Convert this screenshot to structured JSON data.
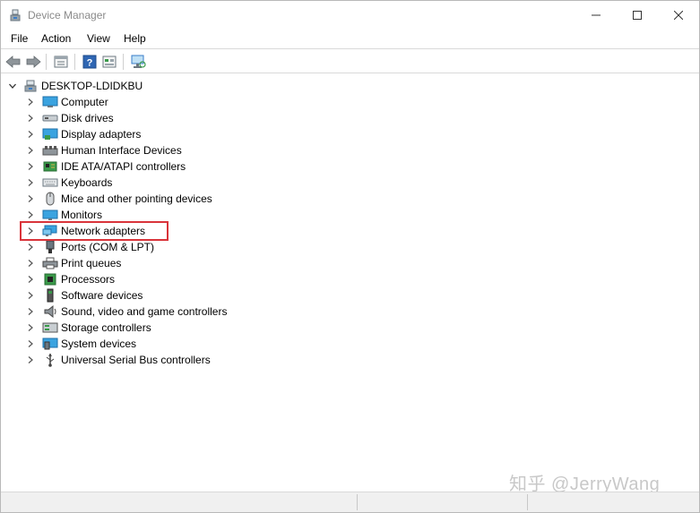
{
  "window": {
    "title": "Device Manager",
    "controls": {
      "minimize": "minimize-icon",
      "maximize": "maximize-icon",
      "close": "close-icon"
    }
  },
  "menu": [
    "File",
    "Action",
    "View",
    "Help"
  ],
  "toolbar": [
    "back-icon",
    "forward-icon",
    "properties-icon",
    "help-icon",
    "view-icon",
    "scan-hardware-icon"
  ],
  "tree": {
    "root": "DESKTOP-LDIDKBU",
    "categories": [
      {
        "label": "Computer",
        "icon": "computer-icon"
      },
      {
        "label": "Disk drives",
        "icon": "disk-drive-icon"
      },
      {
        "label": "Display adapters",
        "icon": "display-adapter-icon"
      },
      {
        "label": "Human Interface Devices",
        "icon": "hid-icon"
      },
      {
        "label": "IDE ATA/ATAPI controllers",
        "icon": "ide-controller-icon"
      },
      {
        "label": "Keyboards",
        "icon": "keyboard-icon"
      },
      {
        "label": "Mice and other pointing devices",
        "icon": "mouse-icon"
      },
      {
        "label": "Monitors",
        "icon": "monitor-icon"
      },
      {
        "label": "Network adapters",
        "icon": "network-adapter-icon"
      },
      {
        "label": "Ports (COM & LPT)",
        "icon": "port-icon"
      },
      {
        "label": "Print queues",
        "icon": "printer-icon"
      },
      {
        "label": "Processors",
        "icon": "processor-icon"
      },
      {
        "label": "Software devices",
        "icon": "software-device-icon"
      },
      {
        "label": "Sound, video and game controllers",
        "icon": "sound-icon"
      },
      {
        "label": "Storage controllers",
        "icon": "storage-controller-icon"
      },
      {
        "label": "System devices",
        "icon": "system-device-icon"
      },
      {
        "label": "Universal Serial Bus controllers",
        "icon": "usb-icon"
      }
    ]
  },
  "colors": {
    "highlight_border": "#d9343a",
    "title_text": "#8a8a8a"
  },
  "watermark": "知乎 @JerryWang"
}
